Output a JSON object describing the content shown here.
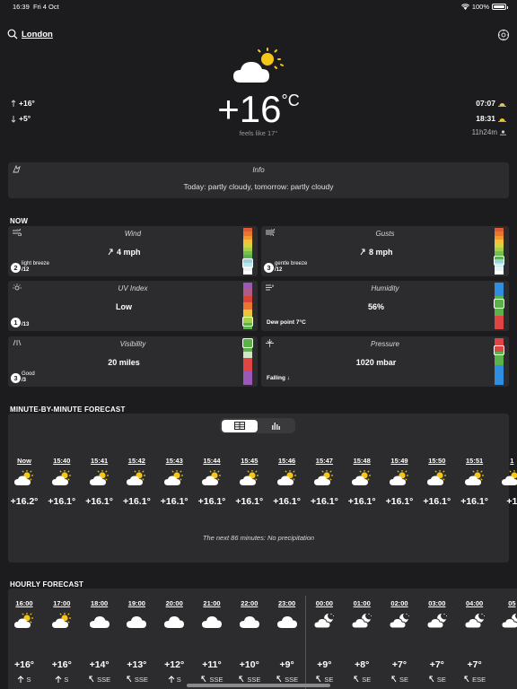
{
  "status": {
    "time": "16:39",
    "date": "Fri 4 Oct",
    "battery": "100%"
  },
  "location": {
    "name": "London",
    "search_icon": "search-icon",
    "settings_icon": "gear-icon"
  },
  "current": {
    "icon": "partly-cloudy-day-icon",
    "temp": "+16",
    "unit": "°C",
    "feels_like": "feels like 17°",
    "high": "+16°",
    "low": "+5°",
    "sunrise": "07:07",
    "sunset": "18:31",
    "day_length": "11h24m"
  },
  "info": {
    "title": "Info",
    "text": "Today: partly cloudy, tomorrow: partly cloudy"
  },
  "now": {
    "section_title": "NOW",
    "wind": {
      "title": "Wind",
      "value": "4 mph",
      "badge": "2",
      "desc": "light breeze",
      "scale_of": "/12",
      "level": 0.17
    },
    "gusts": {
      "title": "Gusts",
      "value": "8 mph",
      "badge": "3",
      "desc": "gentle breeze",
      "scale_of": "/12",
      "level": 0.25
    },
    "uv": {
      "title": "UV Index",
      "value": "Low",
      "badge": "1",
      "scale_of": "/13",
      "level": 0.08
    },
    "humidity": {
      "title": "Humidity",
      "value": "56%",
      "note": "Dew point 7°C",
      "level": 0.56
    },
    "visibility": {
      "title": "Visibility",
      "value": "20 miles",
      "badge": "3",
      "desc": "Good",
      "scale_of": "/3",
      "level": 1.0
    },
    "pressure": {
      "title": "Pressure",
      "value": "1020 mbar",
      "note": "Falling ↓",
      "level": 0.8
    }
  },
  "minute": {
    "section_title": "MINUTE-BY-MINUTE FORECAST",
    "columns": [
      {
        "time": "Now",
        "temp": "+16.2°"
      },
      {
        "time": "15:40",
        "temp": "+16.1°"
      },
      {
        "time": "15:41",
        "temp": "+16.1°"
      },
      {
        "time": "15:42",
        "temp": "+16.1°"
      },
      {
        "time": "15:43",
        "temp": "+16.1°"
      },
      {
        "time": "15:44",
        "temp": "+16.1°"
      },
      {
        "time": "15:45",
        "temp": "+16.1°"
      },
      {
        "time": "15:46",
        "temp": "+16.1°"
      },
      {
        "time": "15:47",
        "temp": "+16.1°"
      },
      {
        "time": "15:48",
        "temp": "+16.1°"
      },
      {
        "time": "15:49",
        "temp": "+16.1°"
      },
      {
        "time": "15:50",
        "temp": "+16.1°"
      },
      {
        "time": "15:51",
        "temp": "+16.1°"
      },
      {
        "time": "1",
        "temp": "+1"
      }
    ],
    "summary": "The next 86 minutes: No precipitation"
  },
  "hourly": {
    "section_title": "HOURLY FORECAST",
    "columns": [
      {
        "time": "16:00",
        "temp": "+16°",
        "wind": "S",
        "icon": "partly-cloudy-day-icon"
      },
      {
        "time": "17:00",
        "temp": "+16°",
        "wind": "S",
        "icon": "partly-cloudy-day-icon"
      },
      {
        "time": "18:00",
        "temp": "+14°",
        "wind": "SSE",
        "icon": "cloud-icon"
      },
      {
        "time": "19:00",
        "temp": "+13°",
        "wind": "SSE",
        "icon": "cloud-icon"
      },
      {
        "time": "20:00",
        "temp": "+12°",
        "wind": "S",
        "icon": "cloud-icon"
      },
      {
        "time": "21:00",
        "temp": "+11°",
        "wind": "SSE",
        "icon": "cloud-icon"
      },
      {
        "time": "22:00",
        "temp": "+10°",
        "wind": "SSE",
        "icon": "cloud-icon"
      },
      {
        "time": "23:00",
        "temp": "+9°",
        "wind": "SSE",
        "icon": "cloud-icon"
      },
      {
        "time": "00:00",
        "temp": "+9°",
        "wind": "SE",
        "icon": "partly-cloudy-night-icon"
      },
      {
        "time": "01:00",
        "temp": "+8°",
        "wind": "SE",
        "icon": "partly-cloudy-night-icon"
      },
      {
        "time": "02:00",
        "temp": "+7°",
        "wind": "SE",
        "icon": "partly-cloudy-night-icon"
      },
      {
        "time": "03:00",
        "temp": "+7°",
        "wind": "SE",
        "icon": "partly-cloudy-night-icon"
      },
      {
        "time": "04:00",
        "temp": "+7°",
        "wind": "ESE",
        "icon": "partly-cloudy-night-icon"
      },
      {
        "time": "05",
        "temp": "",
        "wind": "",
        "icon": "partly-cloudy-night-icon"
      }
    ]
  },
  "colors": {
    "background": "#1c1c1e",
    "card": "#2c2c2e",
    "sun": "#f5c518",
    "cloud": "#ffffff"
  }
}
